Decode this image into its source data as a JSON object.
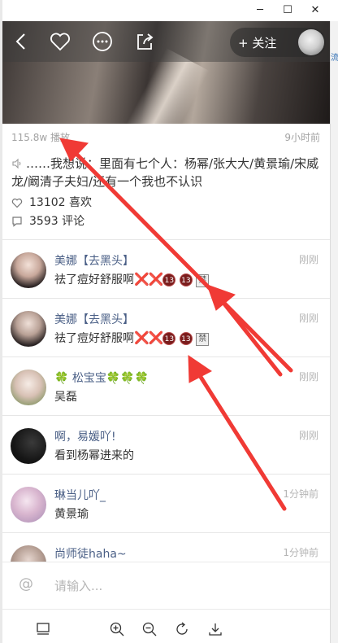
{
  "right_edge_peek": "流",
  "post": {
    "views": "115.8w 播放",
    "time_ago": "9小时前",
    "description": "……我想说：里面有七个人：杨幂/张大大/黄景瑜/宋威龙/阚清子夫妇/还有一个我也不认识",
    "likes": "13102 喜欢",
    "comments": "3593 评论"
  },
  "header": {
    "follow_label": "关注"
  },
  "comments": [
    {
      "username": "美娜【去黑头】",
      "time": "刚刚",
      "text": "祛了痘好舒服啊"
    },
    {
      "username": "美娜【去黑头】",
      "time": "刚刚",
      "text": "祛了痘好舒服啊"
    },
    {
      "username": "松宝宝",
      "time": "刚刚",
      "text": "吴磊"
    },
    {
      "username": "啊，易媛吖!",
      "time": "刚刚",
      "text": "看到杨幂进来的"
    },
    {
      "username": "琳当儿吖_",
      "time": "1分钟前",
      "text": "黄景瑜"
    },
    {
      "username": "尚师徒haha~",
      "time": "1分钟前",
      "text": ""
    }
  ],
  "emoji": {
    "x": "❌",
    "thirteen": "13",
    "ban": "禁",
    "clover": "🍀"
  },
  "composer": {
    "placeholder": "请输入...",
    "at_symbol": "@"
  },
  "colors": {
    "annotation_arrow": "#f03a35",
    "username": "#4a5f86"
  },
  "icons": [
    "back-icon",
    "heart-icon",
    "more-icon",
    "share-icon",
    "speaker-icon",
    "like-icon",
    "comment-icon",
    "layout-icon",
    "zoom-in-icon",
    "zoom-out-icon",
    "rotate-icon",
    "download-icon"
  ]
}
